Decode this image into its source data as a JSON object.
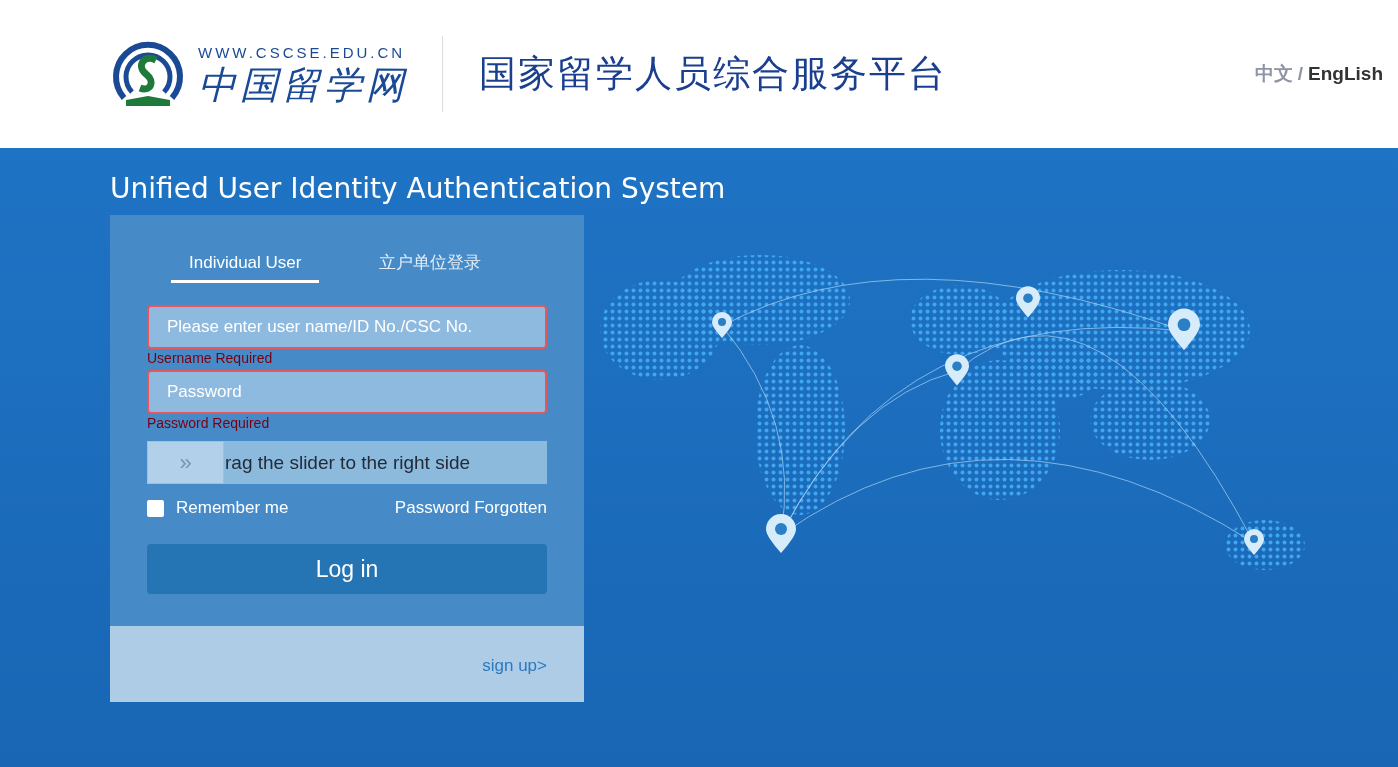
{
  "header": {
    "logo": {
      "url": "WWW.CSCSE.EDU.CN",
      "name": "中国留学网"
    },
    "platform_title": "国家留学人员综合服务平台",
    "languages": [
      {
        "label": "中文",
        "selected": false
      },
      {
        "label": "EngLish",
        "selected": true
      }
    ],
    "language_separator": "/"
  },
  "system_title": "Unified User Identity Authentication System",
  "login": {
    "tabs": [
      {
        "label": "Individual User",
        "selected": true
      },
      {
        "label": "立户单位登录",
        "selected": false
      }
    ],
    "fields": [
      {
        "placeholder": "Please enter user name/ID No./CSC No.",
        "error": "Username Required"
      },
      {
        "placeholder": "Password",
        "error": "Password Required"
      }
    ],
    "slider": {
      "text": "rag the slider to the right side",
      "level": 0,
      "handle": "»"
    },
    "remember": {
      "label": "Remember me",
      "checked": false
    },
    "forgot_link": "Password Forgotten",
    "submit": "Log in",
    "signup_link": "sign up>"
  }
}
